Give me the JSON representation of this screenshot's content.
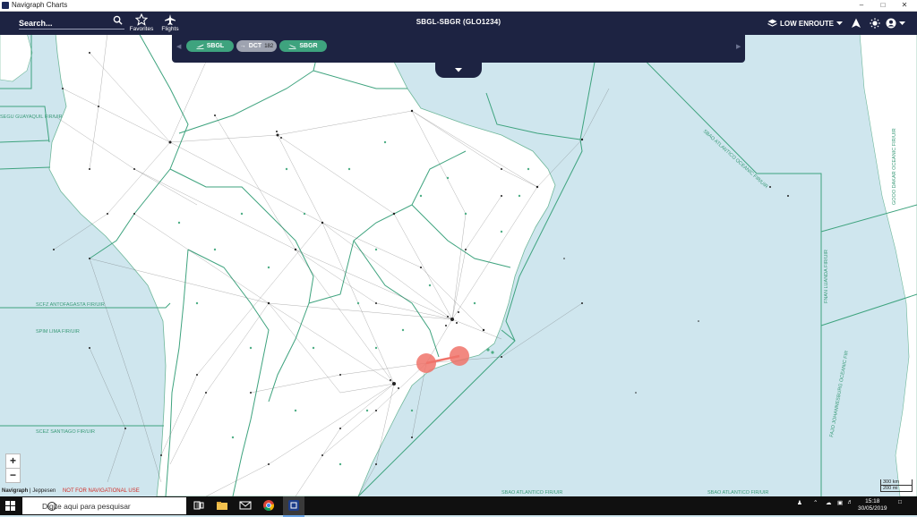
{
  "window": {
    "title": "Navigraph Charts"
  },
  "toolbar": {
    "search_placeholder": "Search...",
    "favorites_label": "Favorites",
    "flights_label": "Flights",
    "route_title": "SBGL-SBGR (GLO1234)",
    "layer_label": "LOW ENROUTE"
  },
  "route": {
    "origin": "SBGL",
    "segment": "DCT",
    "segment_distance": "182",
    "destination": "SBGR"
  },
  "map": {
    "zoom_in": "+",
    "zoom_out": "−",
    "credits_navigraph": "Navigraph",
    "credits_jeppesen": "Jeppesen",
    "not_for_nav": "NOT FOR NAVIGATIONAL USE",
    "scale_km": "300 km",
    "scale_mi": "200 mi",
    "fir_labels": {
      "scfz": "SCFZ ANTOFAGASTA FIR/UIR",
      "scez": "SCEZ SANTIAGO FIR/UIR",
      "sbao": "SBAO ATLANTICO FIR/UIR",
      "sbao_oceanic": "SBAO ATLANTICO OCEANIC FIR/UIR",
      "fapa": "FAJO JOHANNESBURG OCEANIC FIR",
      "fnan": "FNAN LUANDA FIR/UIR",
      "gooo": "GOOO DAKAR OCEANIC FIR/UIR",
      "spim": "SPIM LIMA FIR/UIR",
      "segu": "SEGU GUAYAQUIL FIR/UIR"
    }
  },
  "colors": {
    "water": "#cfe6ee",
    "land": "#ffffff",
    "boundary": "#3ea37e",
    "topbar": "#1d2342",
    "route_marker": "#f0736a"
  },
  "taskbar": {
    "search_placeholder": "Digite aqui para pesquisar",
    "time": "15:18",
    "date": "30/05/2019"
  }
}
